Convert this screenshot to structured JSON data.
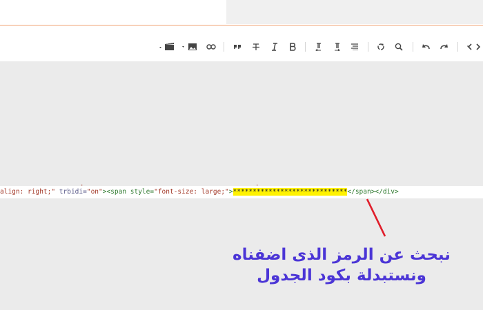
{
  "code": {
    "seg1": "align: right;\"",
    "seg2": " trbidi=",
    "seg3": "\"on\"",
    "seg4": "><span style=",
    "seg5": "\"font-size: large;\"",
    "seg6": ">",
    "highlight": "*****************************",
    "seg7": "</span></div>"
  },
  "annotation": {
    "line1": "نبحث عن الرمز الذى اضفناه",
    "line2": "ونستبدلة بكود الجدول",
    "text_color": "#4b35d6",
    "arrow_color": "#e01e2b"
  },
  "colors": {
    "highlight": "#fff200",
    "editor_bg": "#ebebeb",
    "accent": "#f0a070"
  },
  "toolbar": {
    "icons": [
      "code-view-icon",
      "undo-icon",
      "redo-icon",
      "search-icon",
      "find-replace-icon",
      "align-icon",
      "ltr-icon",
      "rtl-icon",
      "bold-icon",
      "italic-icon",
      "strikethrough-icon",
      "quote-icon",
      "link-icon",
      "image-icon",
      "video-icon"
    ]
  }
}
